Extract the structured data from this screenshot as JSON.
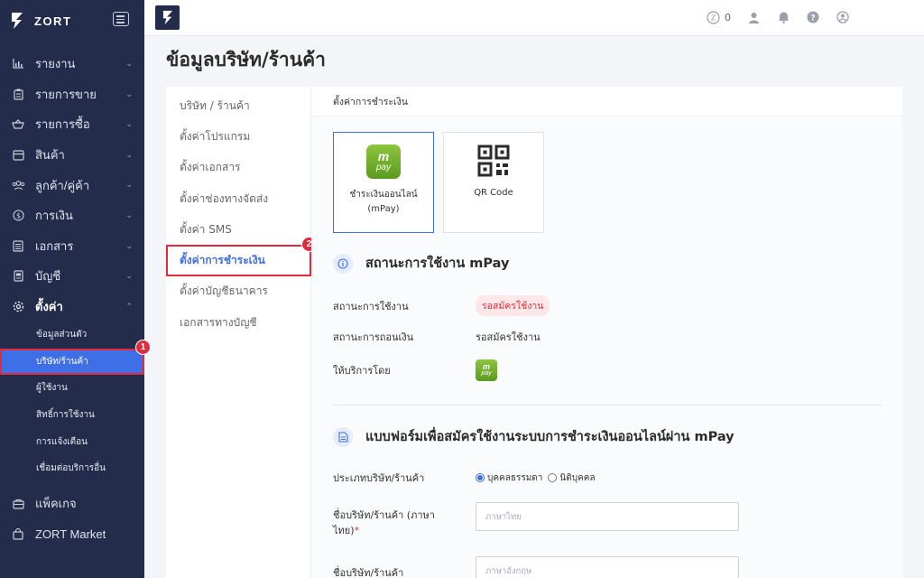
{
  "sidebar": {
    "brand": "ZORT",
    "menu": [
      {
        "label": "รายงาน",
        "icon": "bar-chart-icon"
      },
      {
        "label": "รายการขาย",
        "icon": "clipboard-icon"
      },
      {
        "label": "รายการซื้อ",
        "icon": "basket-icon"
      },
      {
        "label": "สินค้า",
        "icon": "box-icon"
      },
      {
        "label": "ลูกค้า/คู่ค้า",
        "icon": "users-icon"
      },
      {
        "label": "การเงิน",
        "icon": "dollar-icon"
      },
      {
        "label": "เอกสาร",
        "icon": "document-icon"
      },
      {
        "label": "บัญชี",
        "icon": "ledger-icon"
      },
      {
        "label": "ตั้งค่า",
        "icon": "gear-icon"
      }
    ],
    "settings_sub": [
      "ข้อมูลส่วนตัว",
      "บริษัท/ร้านค้า",
      "ผู้ใช้งาน",
      "สิทธิ์การใช้งาน",
      "การแจ้งเตือน",
      "เชื่อมต่อบริการอื่น"
    ],
    "bottom": [
      {
        "label": "แพ็คเกจ",
        "icon": "package-icon"
      },
      {
        "label": "ZORT Market",
        "icon": "shopping-bag-icon"
      }
    ],
    "marker": "1"
  },
  "topbar": {
    "coin_count": "0"
  },
  "page": {
    "title": "ข้อมูลบริษัท/ร้านค้า"
  },
  "settings_menu": {
    "items": [
      "บริษัท / ร้านค้า",
      "ตั้งค่าโปรแกรม",
      "ตั้งค่าเอกสาร",
      "ตั้งค่าช่องทางจัดส่ง",
      "ตั้งค่า SMS",
      "ตั้งค่าการชำระเงิน",
      "ตั้งค่าบัญชีธนาคาร",
      "เอกสารทางบัญชี"
    ],
    "marker": "2"
  },
  "payment": {
    "section_title": "ตั้งค่าการชำระเงิน",
    "cards": [
      {
        "label_line1": "ชำระเงินออนไลน์",
        "label_line2": "(mPay)",
        "logo_text_m": "m",
        "logo_text_pay": "pay"
      },
      {
        "label_line1": "QR Code",
        "label_line2": ""
      }
    ],
    "status_heading": "สถานะการใช้งาน mPay",
    "status_rows": [
      {
        "key": "สถานะการใช้งาน",
        "value": "รอสมัครใช้งาน"
      },
      {
        "key": "สถานะการถอนเงิน",
        "value": "รอสมัครใช้งาน"
      },
      {
        "key": "ให้บริการโดย",
        "value": ""
      }
    ],
    "form_heading": "แบบฟอร์มเพื่อสมัครใช้งานระบบการชำระเงินออนไลน์ผ่าน mPay",
    "company_type_label": "ประเภทบริษัท/ร้านค้า",
    "company_type_options": [
      "บุคคลธรรมดา",
      "นิติบุคคล"
    ],
    "name_th_label_1": "ชื่อบริษัท/ร้านค้า (ภาษา",
    "name_th_label_2": "ไทย)",
    "name_th_required": "*",
    "name_th_placeholder": "ภาษาไทย",
    "name_en_label": "ชื่อบริษัท/ร้านค้า",
    "name_en_placeholder": "ภาษาอังกฤษ"
  },
  "colors": {
    "sidebar_bg": "#232d4b",
    "accent": "#3f6fe6",
    "highlight": "#e02b3c",
    "mpay_green": "#6fad2b"
  }
}
